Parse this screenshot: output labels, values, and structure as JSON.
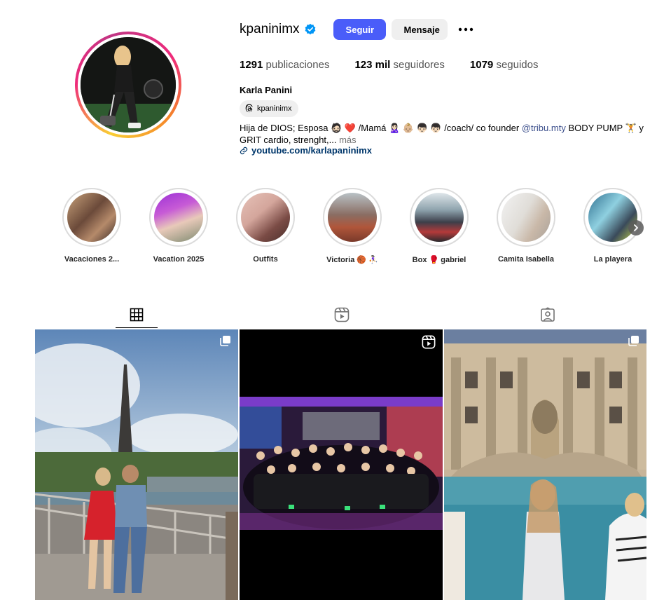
{
  "profile": {
    "username": "kpaninimx",
    "verified": true,
    "follow_label": "Seguir",
    "message_label": "Mensaje",
    "more_icon": "more-horizontal-icon",
    "stats": {
      "posts_value": "1291",
      "posts_label": "publicaciones",
      "followers_value": "123 mil",
      "followers_label": "seguidores",
      "following_value": "1079",
      "following_label": "seguidos"
    },
    "full_name": "Karla Panini",
    "threads_handle": "kpaninimx",
    "bio_line1": "Hija de DIOS; Esposa 🧔🏻 ❤️ /Mamá 🙎🏻‍♀️ 👶🏼 👦🏻 👦🏻 /coach/ co founder",
    "bio_mention": "@tribu.mty",
    "bio_line1_end": " BODY PUMP 🏋️ y",
    "bio_line2": "GRIT cardio, strenght,... ",
    "bio_more": "más",
    "link": "youtube.com/karlapaninimx"
  },
  "highlights": [
    {
      "label": "Vacaciones 2..."
    },
    {
      "label": "Vacation 2025"
    },
    {
      "label": "Outfits"
    },
    {
      "label": "Victoria 🏀 ⛹🏻‍♀️"
    },
    {
      "label": "Box 🥊 gabriel"
    },
    {
      "label": "Camita Isabella"
    },
    {
      "label": "La playera"
    }
  ],
  "tabs": [
    {
      "name": "posts",
      "icon": "grid-icon",
      "active": true
    },
    {
      "name": "reels",
      "icon": "reels-icon",
      "active": false
    },
    {
      "name": "tagged",
      "icon": "tagged-icon",
      "active": false
    }
  ],
  "colors": {
    "accent": "#4a5df9",
    "verified": "#0095f6",
    "link": "#00376b"
  }
}
